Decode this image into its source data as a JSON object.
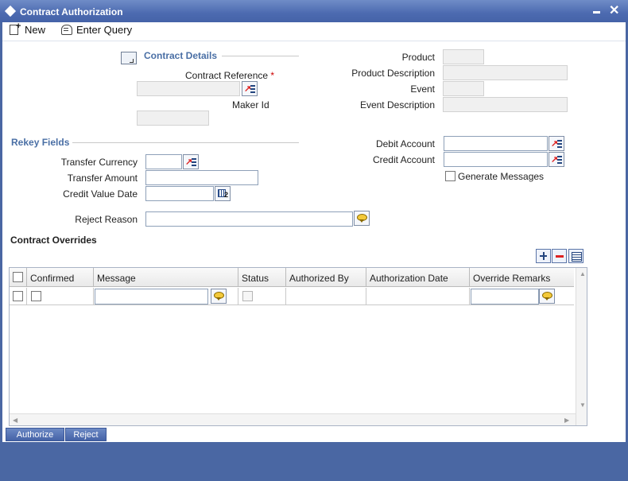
{
  "window": {
    "title": "Contract Authorization"
  },
  "toolbar": {
    "new_label": "New",
    "enter_query_label": "Enter Query"
  },
  "contract_details": {
    "section_title": "Contract Details",
    "contract_reference_label": "Contract Reference",
    "required_marker": "*",
    "contract_reference_value": "",
    "maker_id_label": "Maker Id",
    "maker_id_value": "",
    "product_label": "Product",
    "product_value": "",
    "product_description_label": "Product Description",
    "product_description_value": "",
    "event_label": "Event",
    "event_value": "",
    "event_description_label": "Event Description",
    "event_description_value": ""
  },
  "rekey_fields": {
    "section_title": "Rekey Fields",
    "transfer_currency_label": "Transfer Currency",
    "transfer_currency_value": "",
    "transfer_amount_label": "Transfer Amount",
    "transfer_amount_value": "",
    "credit_value_date_label": "Credit Value Date",
    "credit_value_date_value": "",
    "debit_account_label": "Debit Account",
    "debit_account_value": "",
    "credit_account_label": "Credit Account",
    "credit_account_value": "",
    "generate_messages_label": "Generate Messages",
    "generate_messages_checked": false,
    "reject_reason_label": "Reject Reason",
    "reject_reason_value": ""
  },
  "overrides": {
    "section_title": "Contract Overrides",
    "columns": [
      "Confirmed",
      "Message",
      "Status",
      "Authorized By",
      "Authorization Date",
      "Override Remarks"
    ],
    "rows": [
      {
        "confirmed": false,
        "message": "",
        "status": false,
        "authorized_by": "",
        "authorization_date": "",
        "override_remarks": ""
      }
    ]
  },
  "footer": {
    "authorize_label": "Authorize",
    "reject_label": "Reject"
  },
  "icons": {
    "new": "new-document-icon",
    "enter_query": "query-icon",
    "lov": "list-of-values-icon",
    "calendar": "calendar-icon",
    "text_bubble": "text-editor-icon",
    "add_row": "plus-icon",
    "delete_row": "minus-icon",
    "single_view": "list-view-icon"
  },
  "colors": {
    "title_bar": "#4c6ab0",
    "section_title": "#4a6fa5",
    "required": "#cc0000"
  }
}
